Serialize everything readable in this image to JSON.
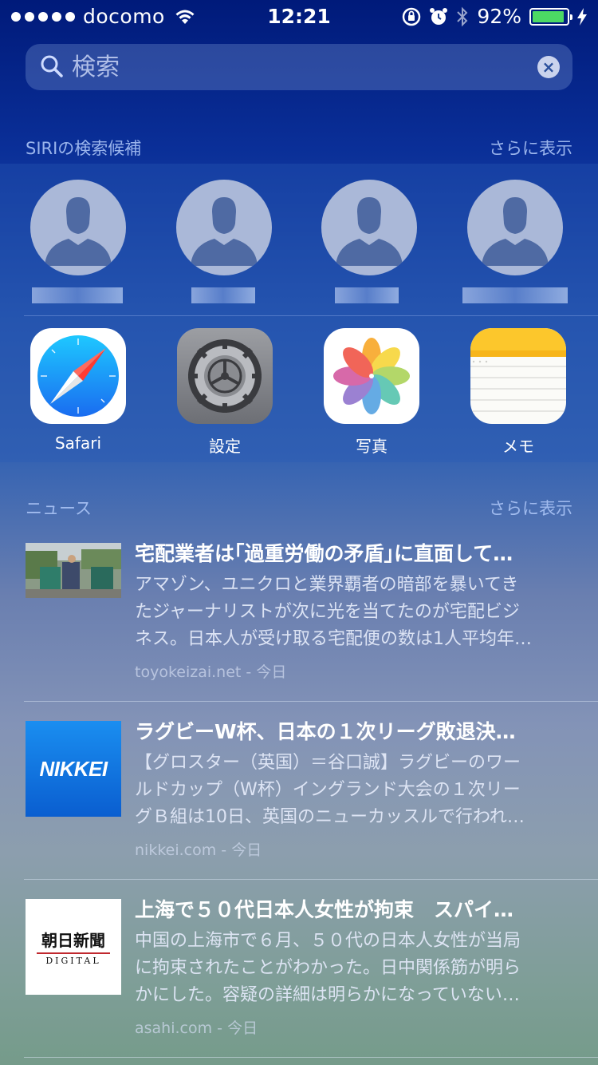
{
  "status_bar": {
    "carrier": "docomo",
    "time": "12:21",
    "battery_pct": "92%",
    "battery_color": "#4cd964"
  },
  "search": {
    "placeholder": "検索",
    "value": ""
  },
  "siri": {
    "header": "SIRIの検索候補",
    "more_label": "さらに表示",
    "contacts": [
      "",
      "",
      "",
      ""
    ],
    "apps": [
      {
        "label": "Safari",
        "icon": "safari-icon"
      },
      {
        "label": "設定",
        "icon": "settings-icon"
      },
      {
        "label": "写真",
        "icon": "photos-icon"
      },
      {
        "label": "メモ",
        "icon": "notes-icon"
      }
    ]
  },
  "news": {
    "header": "ニュース",
    "more_label": "さらに表示",
    "items": [
      {
        "title": "宅配業者は｢過重労働の矛盾｣に直面して…",
        "lines": [
          "アマゾン、ユニクロと業界覇者の暗部を暴いてき",
          "たジャーナリストが次に光を当てたのが宅配ビジ",
          "ネス。日本人が受け取る宅配便の数は1人平均年…"
        ],
        "source": "toyokeizai.net",
        "date": "今日",
        "thumb": "delivery-photo"
      },
      {
        "title": "ラグビーW杯、日本の１次リーグ敗退決…",
        "lines": [
          "【グロスター（英国）＝谷口誠】ラグビーのワー",
          "ルドカップ（W杯）イングランド大会の１次リー",
          "グＢ組は10日、英国のニューカッスルで行われ…"
        ],
        "source": "nikkei.com",
        "date": "今日",
        "thumb": "nikkei-logo",
        "logo_text": "NIKKEI"
      },
      {
        "title": "上海で５０代日本人女性が拘束　スパイ…",
        "lines": [
          "中国の上海市で６月、５０代の日本人女性が当局",
          "に拘束されたことがわかった。日中関係筋が明ら",
          "かにした。容疑の詳細は明らかになっていない…"
        ],
        "source": "asahi.com",
        "date": "今日",
        "thumb": "asahi-logo",
        "logo_text": "朝日新聞",
        "logo_sub": "DIGITAL"
      }
    ]
  }
}
